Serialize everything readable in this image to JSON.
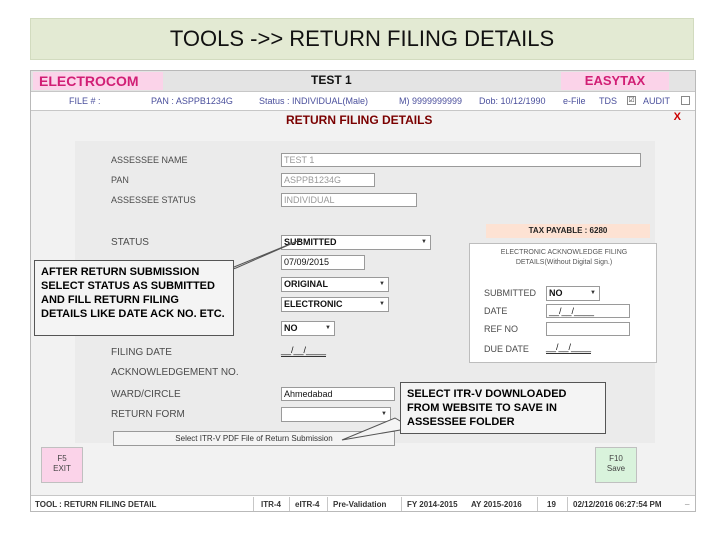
{
  "slide_title": "TOOLS ->> RETURN FILING DETAILS",
  "header": {
    "brand_left": "ELECTROCOM",
    "firm_name": "TEST 1",
    "brand_right": "EASYTAX"
  },
  "infobar": {
    "file_no": "FILE # :",
    "pan": "PAN : ASPPB1234G",
    "status": "Status : INDIVIDUAL(Male)",
    "mobile": "M) 9999999999",
    "dob": "Dob: 10/12/1990",
    "efile": "e-File",
    "tds": "TDS",
    "tds_check": "☑",
    "audit": "AUDIT"
  },
  "form_title": "RETURN FILING DETAILS",
  "close_label": "X",
  "fields": {
    "assessee_name_label": "ASSESSEE NAME",
    "assessee_name_value": "TEST 1",
    "pan_label": "PAN",
    "pan_value": "ASPPB1234G",
    "assessee_status_label": "ASSESSEE STATUS",
    "assessee_status_value": "INDIVIDUAL",
    "status_label": "STATUS",
    "status_value": "SUBMITTED",
    "date_value": "07/09/2015",
    "return_type_value": "ORIGINAL",
    "mode_value": "ELECTRONIC",
    "revised_value": "NO",
    "filing_date_label": "FILING DATE",
    "filing_date_value": "__/__/____",
    "ack_no_label": "ACKNOWLEDGEMENT NO.",
    "ward_label": "WARD/CIRCLE",
    "ward_value": "Ahmedabad",
    "return_form_label": "RETURN FORM"
  },
  "tax_payable": "TAX PAYABLE : 6280",
  "ack_panel": {
    "title": "ELECTRONIC ACKNOWLEDGE FILING DETAILS(Without Digital Sign.)",
    "submitted_label": "SUBMITTED",
    "submitted_value": "NO",
    "date_label": "DATE",
    "date_value": "__/__/____",
    "ref_no_label": "REF NO",
    "due_date_label": "DUE DATE",
    "due_date_value": "__/__/____"
  },
  "upload_button": "Select ITR-V PDF File of Return Submission",
  "f5_exit": {
    "key": "F5",
    "label": "EXIT"
  },
  "f10_save": {
    "key": "F10",
    "label": "Save"
  },
  "statusbar": {
    "tool": "TOOL : RETURN FILING DETAIL",
    "itr4": "ITR-4",
    "eitr4": "eITR-4",
    "prevalidation": "Pre-Validation",
    "fy": "FY 2014-2015",
    "ay": "AY 2015-2016",
    "count": "19",
    "datetime": "02/12/2016 06:27:54 PM",
    "minimize": "_"
  },
  "callouts": {
    "left": "AFTER RETURN SUBMISSION SELECT STATUS AS SUBMITTED AND FILL RETURN FILING DETAILS LIKE DATE ACK NO. ETC.",
    "right": "SELECT ITR-V DOWNLOADED FROM WEBSITE TO SAVE IN ASSESSEE FOLDER"
  },
  "colors": {
    "brand": "#d11e75",
    "brand_bg": "#fbd3e9",
    "title_red": "#7a0000",
    "tax_bg": "#fde2d3",
    "f5_bg": "#fbd3e9",
    "f10_bg": "#d9f3dc"
  }
}
